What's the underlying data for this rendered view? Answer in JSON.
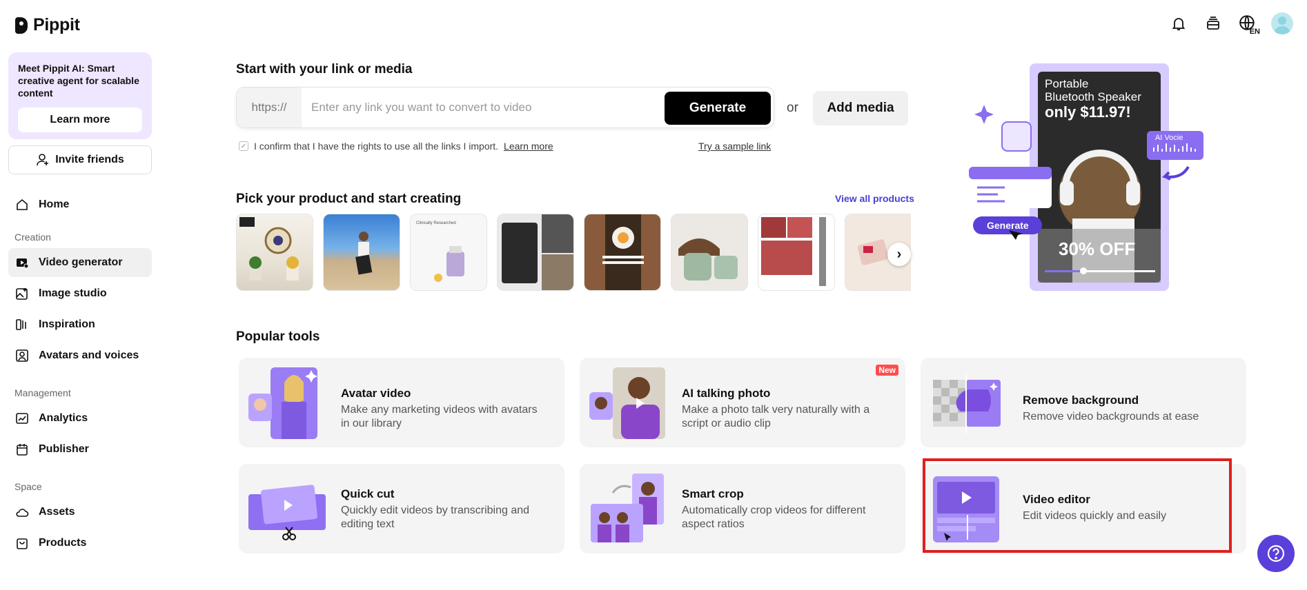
{
  "brand": {
    "name": "Pippit"
  },
  "sidebar": {
    "promo": {
      "text": "Meet Pippit AI: Smart creative agent for scalable content",
      "button": "Learn more"
    },
    "invite": "Invite friends",
    "home": "Home",
    "sections": {
      "creation": "Creation",
      "management": "Management",
      "space": "Space"
    },
    "creation_items": [
      {
        "label": "Video generator",
        "icon": "video-generator-icon",
        "active": true
      },
      {
        "label": "Image studio",
        "icon": "image-studio-icon"
      },
      {
        "label": "Inspiration",
        "icon": "inspiration-icon"
      },
      {
        "label": "Avatars and voices",
        "icon": "avatar-icon"
      }
    ],
    "management_items": [
      {
        "label": "Analytics",
        "icon": "analytics-icon"
      },
      {
        "label": "Publisher",
        "icon": "calendar-icon"
      }
    ],
    "space_items": [
      {
        "label": "Assets",
        "icon": "cloud-icon"
      },
      {
        "label": "Products",
        "icon": "bag-icon"
      }
    ]
  },
  "header": {
    "icons": [
      "bell-icon",
      "layers-icon",
      "globe-icon",
      "avatar"
    ],
    "language": "EN"
  },
  "link_section": {
    "title": "Start with your link or media",
    "prefix": "https://",
    "placeholder": "Enter any link you want to convert to video",
    "generate": "Generate",
    "or": "or",
    "add_media": "Add media",
    "confirm_text": "I confirm that I have the rights to use all the links I import.",
    "learn_more": "Learn more",
    "sample_link": "Try a sample link"
  },
  "products": {
    "title": "Pick your product and start creating",
    "view_all": "View all products"
  },
  "hero": {
    "line1": "Portable",
    "line2": "Bluetooth Speaker",
    "price": "only $11.97!",
    "discount": "30% OFF",
    "ai_voice": "AI Vocie",
    "generate": "Generate"
  },
  "tools": {
    "title": "Popular tools",
    "items": [
      {
        "title": "Avatar video",
        "desc": "Make any marketing videos with avatars in our library"
      },
      {
        "title": "AI talking photo",
        "desc": "Make a photo talk very naturally with a script or audio clip",
        "badge": "New"
      },
      {
        "title": "Remove background",
        "desc": "Remove video backgrounds at ease"
      },
      {
        "title": "Quick cut",
        "desc": "Quickly edit videos by transcribing and editing text"
      },
      {
        "title": "Smart crop",
        "desc": "Automatically crop videos for different aspect ratios"
      },
      {
        "title": "Video editor",
        "desc": "Edit videos quickly and easily"
      }
    ]
  }
}
